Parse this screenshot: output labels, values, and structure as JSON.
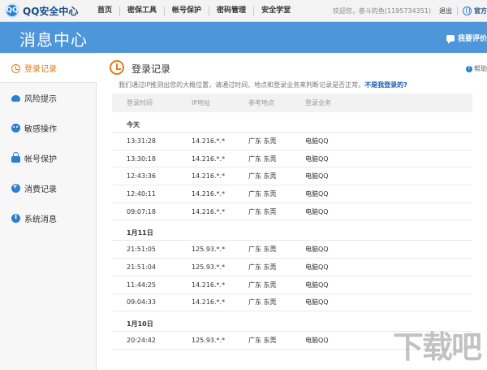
{
  "topbar": {
    "logo_badge": "QQ",
    "logo_text": "QQ安全中心",
    "nav": [
      "首页",
      "密保工具",
      "帐号保护",
      "密码管理",
      "安全学堂"
    ],
    "greeting": "欢迎您，奋斗的鱼(1195734351)",
    "logout": "退出",
    "official": "官方"
  },
  "header": {
    "title": "消息中心",
    "feedback": "我要评价"
  },
  "sidebar": {
    "items": [
      {
        "label": "登录记录",
        "icon": "clock-icon",
        "active": true
      },
      {
        "label": "风险提示",
        "icon": "cloud-icon"
      },
      {
        "label": "敏感操作",
        "icon": "face-icon"
      },
      {
        "label": "帐号保护",
        "icon": "lock-icon"
      },
      {
        "label": "消费记录",
        "icon": "coin-icon"
      },
      {
        "label": "系统消息",
        "icon": "info-icon"
      }
    ]
  },
  "main": {
    "title": "登录记录",
    "help": "帮助",
    "hint": "我们通过IP推测出您的大概位置，请通过时间、地点和登录业务来判断记录是否正常。",
    "hint_link": "不是我登录的?",
    "columns": [
      "登录时间",
      "IP地址",
      "参考地点",
      "登录业务"
    ],
    "groups": [
      {
        "title": "今天",
        "rows": [
          [
            "13:31:28",
            "14.216.*.*",
            "广东 东莞",
            "电脑QQ"
          ],
          [
            "13:30:18",
            "14.216.*.*",
            "广东 东莞",
            "电脑QQ"
          ],
          [
            "12:43:36",
            "14.216.*.*",
            "广东 东莞",
            "电脑QQ"
          ],
          [
            "12:40:11",
            "14.216.*.*",
            "广东 东莞",
            "电脑QQ"
          ],
          [
            "09:07:18",
            "14.216.*.*",
            "广东 东莞",
            "电脑QQ"
          ]
        ]
      },
      {
        "title": "1月11日",
        "rows": [
          [
            "21:51:05",
            "125.93.*.*",
            "广东 东莞",
            "电脑QQ"
          ],
          [
            "21:51:04",
            "125.93.*.*",
            "广东 东莞",
            "电脑QQ"
          ],
          [
            "11:44:25",
            "14.216.*.*",
            "广东 东莞",
            "电脑QQ"
          ],
          [
            "09:04:33",
            "14.216.*.*",
            "广东 东莞",
            "电脑QQ"
          ]
        ]
      },
      {
        "title": "1月10日",
        "rows": [
          [
            "20:24:42",
            "125.93.*.*",
            "广东 东莞",
            "电脑QQ"
          ]
        ]
      }
    ]
  },
  "watermark": "下载吧"
}
